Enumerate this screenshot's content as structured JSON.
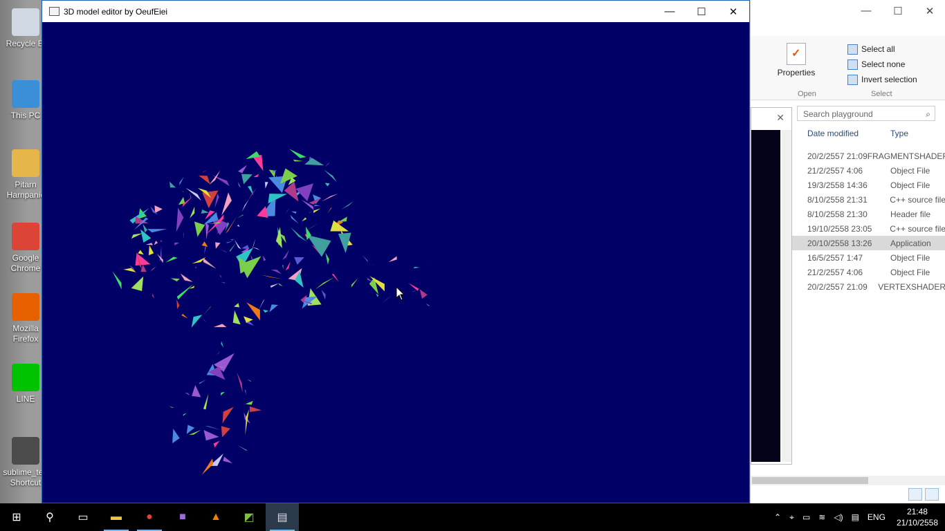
{
  "desktop": {
    "icons": [
      {
        "label": "Recycle Bi",
        "icon": "recycle-bin-icon",
        "color": "#cfd8e3"
      },
      {
        "label": "This PC",
        "icon": "computer-icon",
        "color": "#3a8fd8"
      },
      {
        "label": "Pitarn Harnpanic",
        "icon": "user-folder-icon",
        "color": "#e5b64a"
      },
      {
        "label": "Google Chrome",
        "icon": "chrome-icon",
        "color": "#db4437"
      },
      {
        "label": "Mozilla Firefox",
        "icon": "firefox-icon",
        "color": "#e66000"
      },
      {
        "label": "LINE",
        "icon": "line-icon",
        "color": "#00c300"
      },
      {
        "label": "sublime_te - Shortcut",
        "icon": "sublime-icon",
        "color": "#4b4b4b"
      }
    ]
  },
  "main_window": {
    "title": "3D model editor by OeufEiei",
    "minimize": "—",
    "maximize": "☐",
    "close": "✕",
    "background": "#000066"
  },
  "explorer": {
    "ribbon": {
      "properties": "Properties",
      "select_all": "Select all",
      "select_none": "Select none",
      "invert_selection": "Invert selection",
      "group_open": "Open",
      "group_select": "Select"
    },
    "search_placeholder": "Search playground",
    "columns": {
      "date": "Date modified",
      "type": "Type"
    },
    "rows": [
      {
        "date": "20/2/2557 21:09",
        "type": "FRAGMENTSHADER"
      },
      {
        "date": "21/2/2557 4:06",
        "type": "Object File"
      },
      {
        "date": "19/3/2558 14:36",
        "type": "Object File"
      },
      {
        "date": "8/10/2558 21:31",
        "type": "C++ source file"
      },
      {
        "date": "8/10/2558 21:30",
        "type": "Header file"
      },
      {
        "date": "19/10/2558 23:05",
        "type": "C++ source file"
      },
      {
        "date": "20/10/2558 13:26",
        "type": "Application",
        "selected": true
      },
      {
        "date": "16/5/2557 1:47",
        "type": "Object File"
      },
      {
        "date": "21/2/2557 4:06",
        "type": "Object File"
      },
      {
        "date": "20/2/2557 21:09",
        "type": "VERTEXSHADER"
      }
    ]
  },
  "taskbar": {
    "language": "ENG",
    "time": "21:48",
    "date": "21/10/2558"
  }
}
